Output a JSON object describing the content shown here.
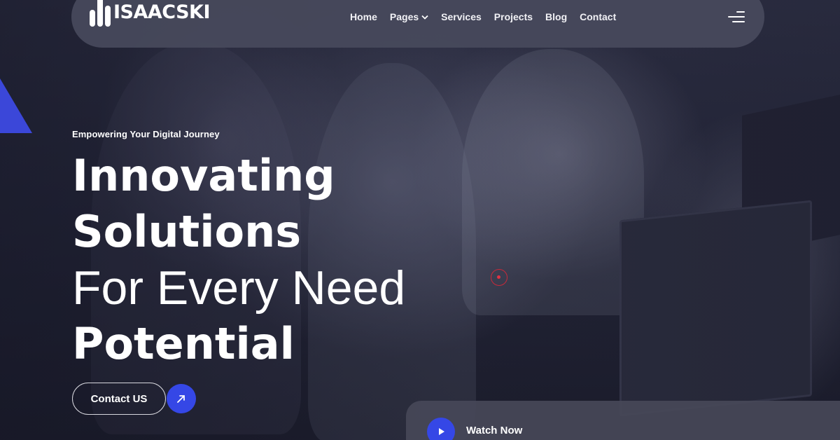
{
  "brand": {
    "name": "ISAACSKI",
    "accent_color": "#3547e6"
  },
  "nav": {
    "items": [
      {
        "label": "Home"
      },
      {
        "label": "Pages",
        "icon": "chevron-down-icon"
      },
      {
        "label": "Services"
      },
      {
        "label": "Projects"
      },
      {
        "label": "Blog"
      },
      {
        "label": "Contact"
      }
    ],
    "menu_icon": "hamburger-menu-icon"
  },
  "hero": {
    "eyebrow": "Empowering Your Digital Journey",
    "headline": {
      "line1": "Innovating",
      "line2": "Solutions",
      "line3": "For Every Need",
      "line4": "Potential"
    },
    "cta_label": "Contact US",
    "cta_icon": "arrow-up-right-icon"
  },
  "video": {
    "label": "Watch Now",
    "icon": "play-icon"
  }
}
